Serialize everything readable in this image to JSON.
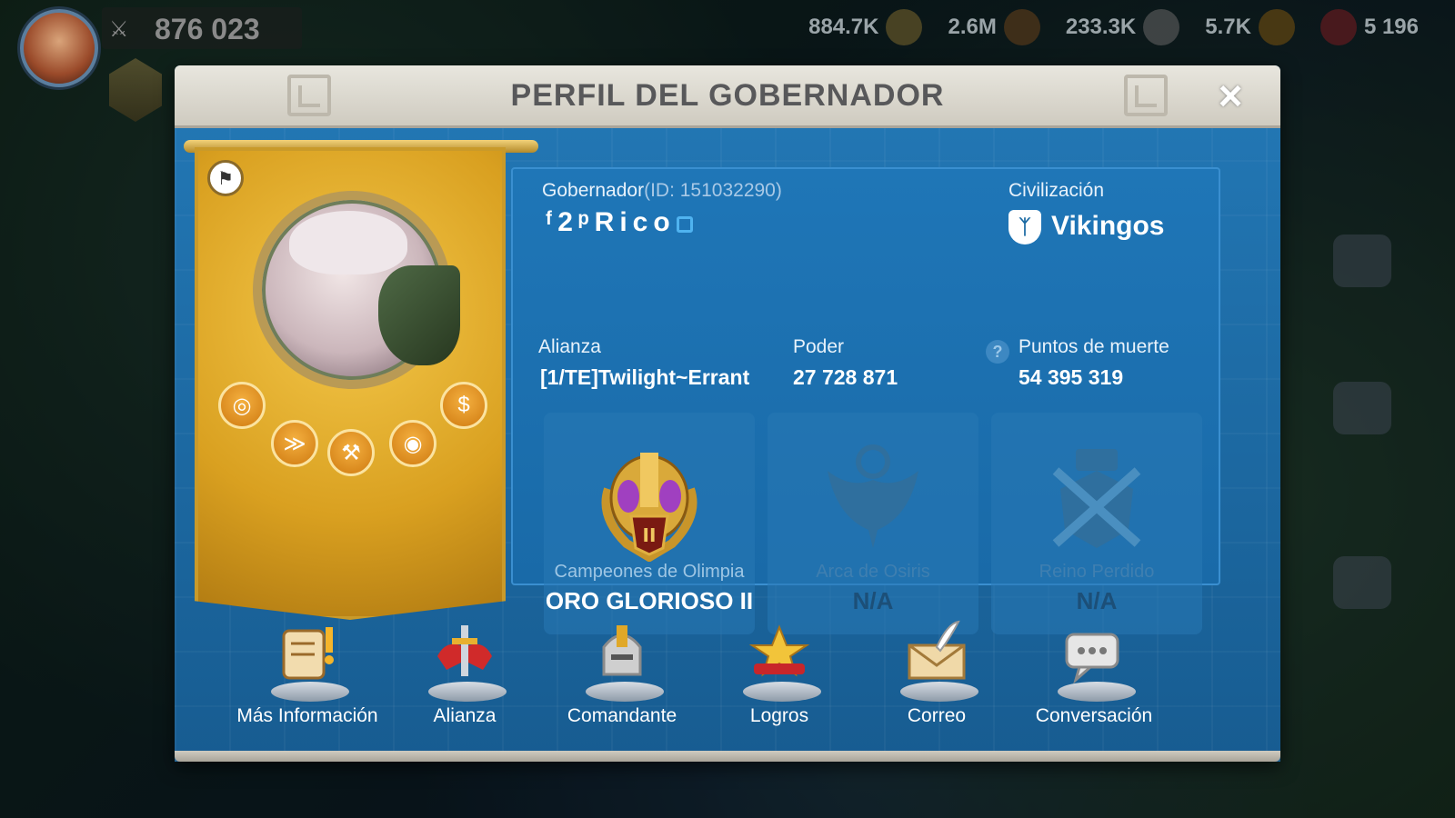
{
  "hud": {
    "power": "876 023",
    "resources": [
      {
        "icon": "corn-icon",
        "value": "884.7K",
        "color": "#d6b23a"
      },
      {
        "icon": "wood-icon",
        "value": "2.6M",
        "color": "#b06a2a"
      },
      {
        "icon": "stone-icon",
        "value": "233.3K",
        "color": "#a8a8a8"
      },
      {
        "icon": "gold-icon",
        "value": "5.7K",
        "color": "#d9a020"
      },
      {
        "icon": "gem-icon",
        "value": "5 196",
        "color": "#d0303a"
      }
    ]
  },
  "dialog": {
    "title": "PERFIL DEL GOBERNADOR",
    "close_icon": "×"
  },
  "governor": {
    "label": "Gobernador",
    "id_text": "(ID: 151032290)",
    "name": "ᶠ2ᵖRico",
    "civ_label": "Civilización",
    "civ_name": "Vikingos",
    "alliance_label": "Alianza",
    "alliance_value": "[1/TE]Twilight~Errant",
    "power_label": "Poder",
    "power_value": "27 728 871",
    "kill_label": "Puntos de muerte",
    "kill_value": "54 395 319"
  },
  "cards": [
    {
      "name": "Campeones de Olimpia",
      "value": "ORO GLORIOSO II",
      "icon": "olympia-helmet-icon",
      "active": true
    },
    {
      "name": "Arca de Osiris",
      "value": "N/A",
      "icon": "osiris-eagle-icon",
      "active": false
    },
    {
      "name": "Reino Perdido",
      "value": "N/A",
      "icon": "lost-kingdom-swords-icon",
      "active": false
    }
  ],
  "actions": [
    {
      "label": "Más Información",
      "icon": "scroll-icon"
    },
    {
      "label": "Alianza",
      "icon": "alliance-sword-icon"
    },
    {
      "label": "Comandante",
      "icon": "helmet-icon"
    },
    {
      "label": "Logros",
      "icon": "trophy-icon"
    },
    {
      "label": "Correo",
      "icon": "mail-icon"
    },
    {
      "label": "Conversación",
      "icon": "chat-icon"
    }
  ]
}
